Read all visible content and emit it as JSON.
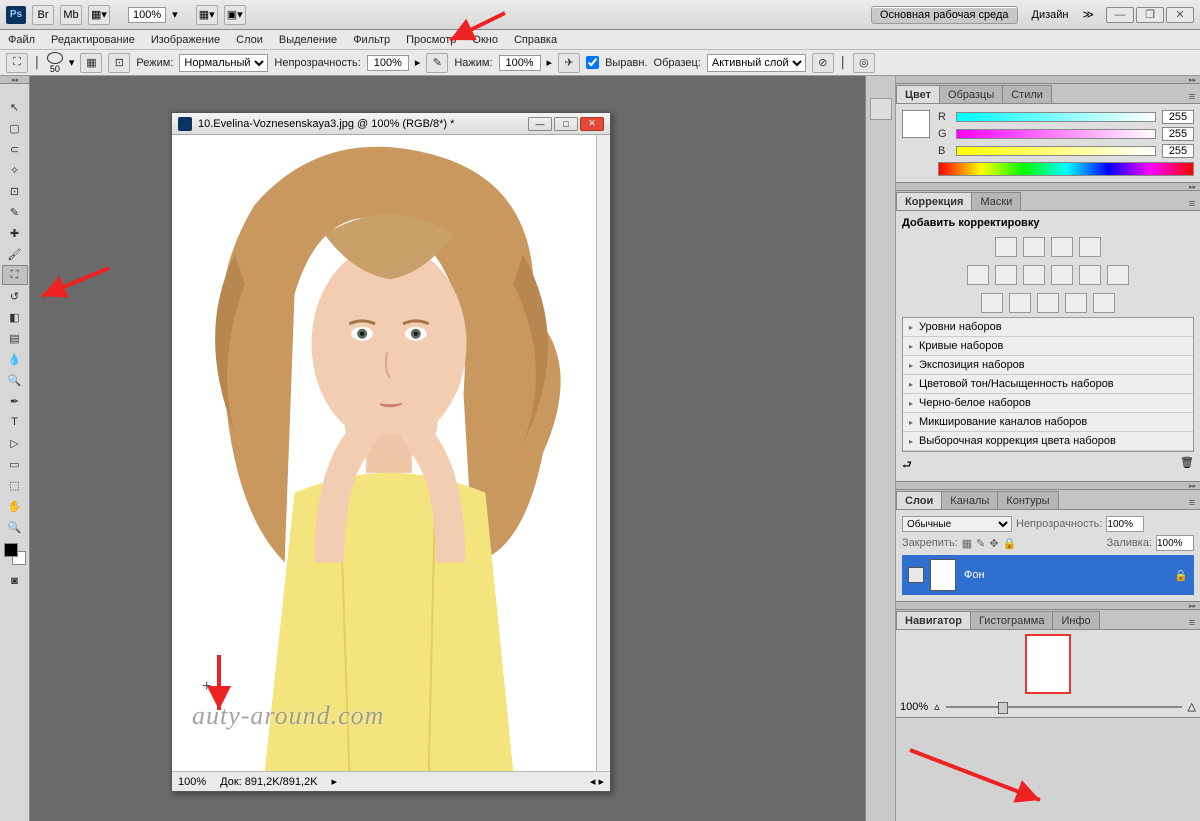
{
  "topbar": {
    "zoom": "100%"
  },
  "workspace": {
    "primary": "Основная рабочая среда",
    "secondary": "Дизайн"
  },
  "menu": [
    "Файл",
    "Редактирование",
    "Изображение",
    "Слои",
    "Выделение",
    "Фильтр",
    "Просмотр",
    "Окно",
    "Справка"
  ],
  "options": {
    "brush_size": "50",
    "mode_lbl": "Режим:",
    "mode_val": "Нормальный",
    "opacity_lbl": "Непрозрачность:",
    "opacity_val": "100%",
    "flow_lbl": "Нажим:",
    "flow_val": "100%",
    "align_lbl": "Выравн.",
    "sample_lbl": "Образец:",
    "sample_val": "Активный слой"
  },
  "doc": {
    "title": "10.Evelina-Voznesenskaya3.jpg @ 100% (RGB/8*) *",
    "status_zoom": "100%",
    "status_doc": "Док: 891,2K/891,2K",
    "watermark": "auty-around.com"
  },
  "color_panel": {
    "tabs": [
      "Цвет",
      "Образцы",
      "Стили"
    ],
    "r": "255",
    "g": "255",
    "b": "255",
    "R": "R",
    "G": "G",
    "B": "B"
  },
  "adjust_panel": {
    "tabs": [
      "Коррекция",
      "Маски"
    ],
    "add_lbl": "Добавить корректировку",
    "presets": [
      "Уровни наборов",
      "Кривые наборов",
      "Экспозиция наборов",
      "Цветовой тон/Насыщенность наборов",
      "Черно-белое наборов",
      "Микширование каналов наборов",
      "Выборочная коррекция цвета наборов"
    ]
  },
  "layers_panel": {
    "tabs": [
      "Слои",
      "Каналы",
      "Контуры"
    ],
    "blend": "Обычные",
    "opacity_lbl": "Непрозрачность:",
    "opacity_val": "100%",
    "lock_lbl": "Закрепить:",
    "fill_lbl": "Заливка:",
    "fill_val": "100%",
    "layer_name": "Фон"
  },
  "nav_panel": {
    "tabs": [
      "Навигатор",
      "Гистограмма",
      "Инфо"
    ],
    "zoom": "100%"
  }
}
